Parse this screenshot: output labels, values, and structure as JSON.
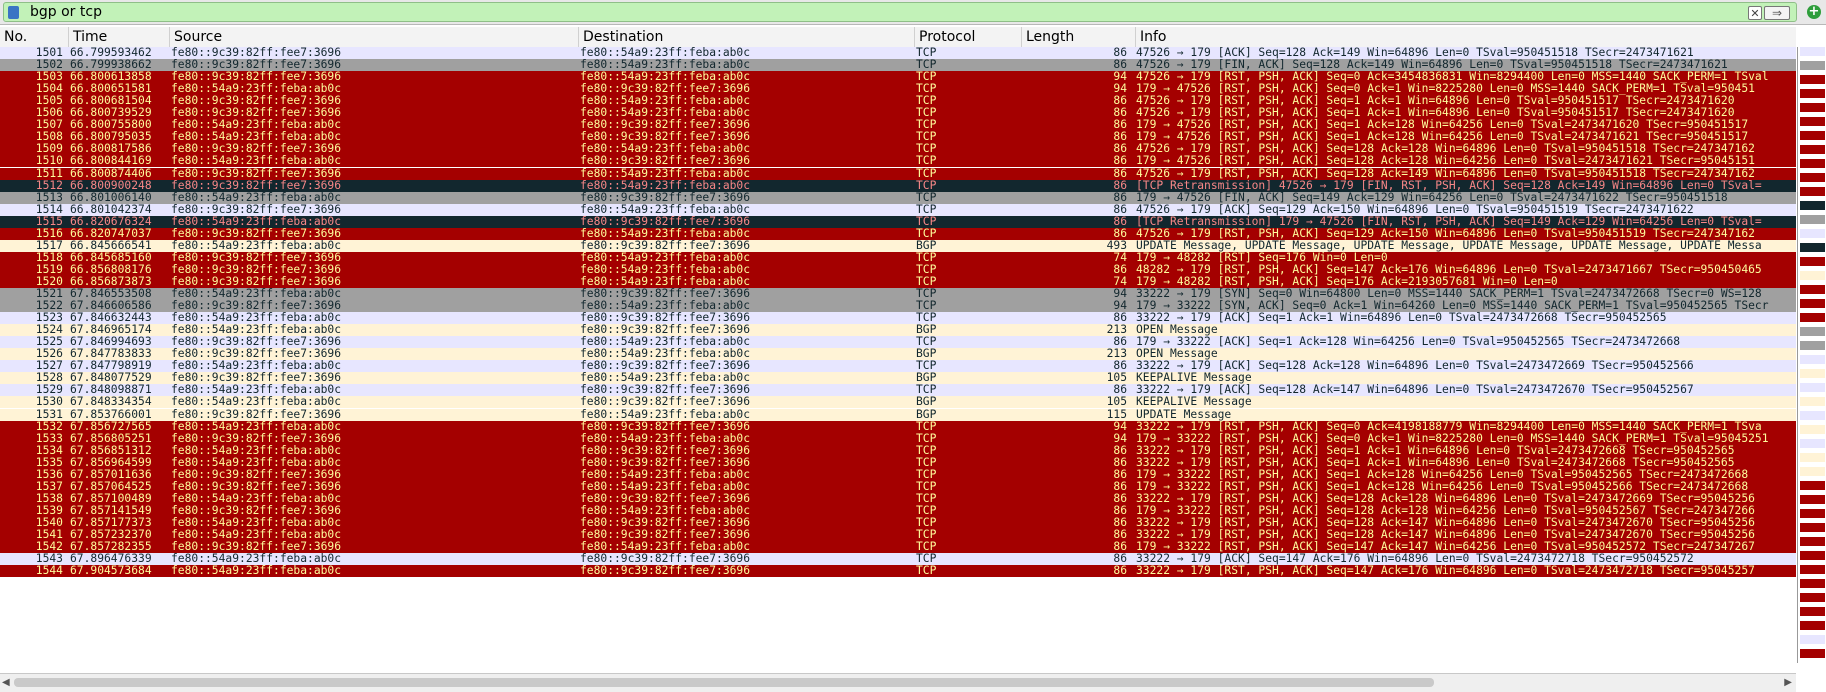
{
  "filter": {
    "text": "bgp or tcp",
    "clear_symbol": "✕",
    "apply_symbol": "⇒",
    "add_symbol": "+"
  },
  "columns": [
    "No.",
    "Time",
    "Source",
    "Destination",
    "Protocol",
    "Length",
    "Info"
  ],
  "row_styles": {
    "red": {
      "bg": "#a40000",
      "fg": "#fffc9c"
    },
    "blue": {
      "bg": "#e7e6ff",
      "fg": "#12272e"
    },
    "gray": {
      "bg": "#a0a0a0",
      "fg": "#12272e"
    },
    "dark": {
      "bg": "#12272e",
      "fg": "#f78787"
    },
    "bgp": {
      "bg": "#fff3d6",
      "fg": "#12272e"
    }
  },
  "packets": [
    {
      "no": "1501",
      "time": "66.799593462",
      "src": "fe80::9c39:82ff:fee7:3696",
      "dst": "fe80::54a9:23ff:feba:ab0c",
      "proto": "TCP",
      "len": "86",
      "info": "47526 → 179 [ACK] Seq=128 Ack=149 Win=64896 Len=0 TSval=950451518 TSecr=2473471621",
      "style": "blue"
    },
    {
      "no": "1502",
      "time": "66.799938662",
      "src": "fe80::9c39:82ff:fee7:3696",
      "dst": "fe80::54a9:23ff:feba:ab0c",
      "proto": "TCP",
      "len": "86",
      "info": "47526 → 179 [FIN, ACK] Seq=128 Ack=149 Win=64896 Len=0 TSval=950451518 TSecr=2473471621",
      "style": "gray"
    },
    {
      "no": "1503",
      "time": "66.800613858",
      "src": "fe80::9c39:82ff:fee7:3696",
      "dst": "fe80::54a9:23ff:feba:ab0c",
      "proto": "TCP",
      "len": "94",
      "info": "47526 → 179 [RST, PSH, ACK] Seq=0 Ack=3454836831 Win=8294400 Len=0 MSS=1440 SACK_PERM=1 TSval",
      "style": "red"
    },
    {
      "no": "1504",
      "time": "66.800651581",
      "src": "fe80::54a9:23ff:feba:ab0c",
      "dst": "fe80::9c39:82ff:fee7:3696",
      "proto": "TCP",
      "len": "94",
      "info": "179 → 47526 [RST, PSH, ACK] Seq=0 Ack=1 Win=8225280 Len=0 MSS=1440 SACK_PERM=1 TSval=950451",
      "style": "red"
    },
    {
      "no": "1505",
      "time": "66.800681504",
      "src": "fe80::9c39:82ff:fee7:3696",
      "dst": "fe80::54a9:23ff:feba:ab0c",
      "proto": "TCP",
      "len": "86",
      "info": "47526 → 179 [RST, PSH, ACK] Seq=1 Ack=1 Win=64896 Len=0 TSval=950451517 TSecr=2473471620",
      "style": "red"
    },
    {
      "no": "1506",
      "time": "66.800739529",
      "src": "fe80::9c39:82ff:fee7:3696",
      "dst": "fe80::54a9:23ff:feba:ab0c",
      "proto": "TCP",
      "len": "86",
      "info": "47526 → 179 [RST, PSH, ACK] Seq=1 Ack=1 Win=64896 Len=0 TSval=950451517 TSecr=2473471620",
      "style": "red"
    },
    {
      "no": "1507",
      "time": "66.800755800",
      "src": "fe80::54a9:23ff:feba:ab0c",
      "dst": "fe80::9c39:82ff:fee7:3696",
      "proto": "TCP",
      "len": "86",
      "info": "179 → 47526 [RST, PSH, ACK] Seq=1 Ack=128 Win=64256 Len=0 TSval=2473471620 TSecr=950451517",
      "style": "red"
    },
    {
      "no": "1508",
      "time": "66.800795035",
      "src": "fe80::54a9:23ff:feba:ab0c",
      "dst": "fe80::9c39:82ff:fee7:3696",
      "proto": "TCP",
      "len": "86",
      "info": "179 → 47526 [RST, PSH, ACK] Seq=1 Ack=128 Win=64256 Len=0 TSval=2473471621 TSecr=950451517",
      "style": "red"
    },
    {
      "no": "1509",
      "time": "66.800817586",
      "src": "fe80::9c39:82ff:fee7:3696",
      "dst": "fe80::54a9:23ff:feba:ab0c",
      "proto": "TCP",
      "len": "86",
      "info": "47526 → 179 [RST, PSH, ACK] Seq=128 Ack=128 Win=64896 Len=0 TSval=950451518 TSecr=247347162",
      "style": "red"
    },
    {
      "no": "1510",
      "time": "66.800844169",
      "src": "fe80::54a9:23ff:feba:ab0c",
      "dst": "fe80::9c39:82ff:fee7:3696",
      "proto": "TCP",
      "len": "86",
      "info": "179 → 47526 [RST, PSH, ACK] Seq=128 Ack=128 Win=64256 Len=0 TSval=2473471621 TSecr=95045151",
      "style": "red"
    },
    {
      "no": "1511",
      "time": "66.800874406",
      "src": "fe80::9c39:82ff:fee7:3696",
      "dst": "fe80::54a9:23ff:feba:ab0c",
      "proto": "TCP",
      "len": "86",
      "info": "47526 → 179 [RST, PSH, ACK] Seq=128 Ack=149 Win=64896 Len=0 TSval=950451518 TSecr=247347162",
      "style": "red"
    },
    {
      "no": "1512",
      "time": "66.800900248",
      "src": "fe80::9c39:82ff:fee7:3696",
      "dst": "fe80::54a9:23ff:feba:ab0c",
      "proto": "TCP",
      "len": "86",
      "info": "[TCP Retransmission] 47526 → 179 [FIN, RST, PSH, ACK] Seq=128 Ack=149 Win=64896 Len=0 TSval=",
      "style": "dark"
    },
    {
      "no": "1513",
      "time": "66.801006140",
      "src": "fe80::54a9:23ff:feba:ab0c",
      "dst": "fe80::9c39:82ff:fee7:3696",
      "proto": "TCP",
      "len": "86",
      "info": "179 → 47526 [FIN, ACK] Seq=149 Ack=129 Win=64256 Len=0 TSval=2473471622 TSecr=950451518",
      "style": "gray"
    },
    {
      "no": "1514",
      "time": "66.801042374",
      "src": "fe80::9c39:82ff:fee7:3696",
      "dst": "fe80::54a9:23ff:feba:ab0c",
      "proto": "TCP",
      "len": "86",
      "info": "47526 → 179 [ACK] Seq=129 Ack=150 Win=64896 Len=0 TSval=950451519 TSecr=2473471622",
      "style": "blue"
    },
    {
      "no": "1515",
      "time": "66.820676324",
      "src": "fe80::54a9:23ff:feba:ab0c",
      "dst": "fe80::9c39:82ff:fee7:3696",
      "proto": "TCP",
      "len": "86",
      "info": "[TCP Retransmission] 179 → 47526 [FIN, RST, PSH, ACK] Seq=149 Ack=129 Win=64256 Len=0 TSval=",
      "style": "dark"
    },
    {
      "no": "1516",
      "time": "66.820747037",
      "src": "fe80::9c39:82ff:fee7:3696",
      "dst": "fe80::54a9:23ff:feba:ab0c",
      "proto": "TCP",
      "len": "86",
      "info": "47526 → 179 [RST, PSH, ACK] Seq=129 Ack=150 Win=64896 Len=0 TSval=950451519 TSecr=247347162",
      "style": "red"
    },
    {
      "no": "1517",
      "time": "66.845666541",
      "src": "fe80::54a9:23ff:feba:ab0c",
      "dst": "fe80::9c39:82ff:fee7:3696",
      "proto": "BGP",
      "len": "493",
      "info": "UPDATE Message, UPDATE Message, UPDATE Message, UPDATE Message, UPDATE Message, UPDATE Messa",
      "style": "bgp"
    },
    {
      "no": "1518",
      "time": "66.845685160",
      "src": "fe80::9c39:82ff:fee7:3696",
      "dst": "fe80::54a9:23ff:feba:ab0c",
      "proto": "TCP",
      "len": "74",
      "info": "179 → 48282 [RST] Seq=176 Win=0 Len=0",
      "style": "red"
    },
    {
      "no": "1519",
      "time": "66.856808176",
      "src": "fe80::9c39:82ff:fee7:3696",
      "dst": "fe80::54a9:23ff:feba:ab0c",
      "proto": "TCP",
      "len": "86",
      "info": "48282 → 179 [RST, PSH, ACK] Seq=147 Ack=176 Win=64896 Len=0 TSval=2473471667 TSecr=950450465",
      "style": "red"
    },
    {
      "no": "1520",
      "time": "66.856873873",
      "src": "fe80::9c39:82ff:fee7:3696",
      "dst": "fe80::54a9:23ff:feba:ab0c",
      "proto": "TCP",
      "len": "74",
      "info": "179 → 48282 [RST, PSH, ACK] Seq=176 Ack=2193057681 Win=0 Len=0",
      "style": "red"
    },
    {
      "no": "1521",
      "time": "67.846553508",
      "src": "fe80::54a9:23ff:feba:ab0c",
      "dst": "fe80::9c39:82ff:fee7:3696",
      "proto": "TCP",
      "len": "94",
      "info": "33222 → 179 [SYN] Seq=0 Win=64800 Len=0 MSS=1440 SACK_PERM=1 TSval=2473472668 TSecr=0 WS=128",
      "style": "gray"
    },
    {
      "no": "1522",
      "time": "67.846606586",
      "src": "fe80::9c39:82ff:fee7:3696",
      "dst": "fe80::54a9:23ff:feba:ab0c",
      "proto": "TCP",
      "len": "94",
      "info": "179 → 33222 [SYN, ACK] Seq=0 Ack=1 Win=64260 Len=0 MSS=1440 SACK_PERM=1 TSval=950452565 TSecr",
      "style": "gray"
    },
    {
      "no": "1523",
      "time": "67.846632443",
      "src": "fe80::54a9:23ff:feba:ab0c",
      "dst": "fe80::9c39:82ff:fee7:3696",
      "proto": "TCP",
      "len": "86",
      "info": "33222 → 179 [ACK] Seq=1 Ack=1 Win=64896 Len=0 TSval=2473472668 TSecr=950452565",
      "style": "blue"
    },
    {
      "no": "1524",
      "time": "67.846965174",
      "src": "fe80::54a9:23ff:feba:ab0c",
      "dst": "fe80::9c39:82ff:fee7:3696",
      "proto": "BGP",
      "len": "213",
      "info": "OPEN Message",
      "style": "bgp"
    },
    {
      "no": "1525",
      "time": "67.846994693",
      "src": "fe80::9c39:82ff:fee7:3696",
      "dst": "fe80::54a9:23ff:feba:ab0c",
      "proto": "TCP",
      "len": "86",
      "info": "179 → 33222 [ACK] Seq=1 Ack=128 Win=64256 Len=0 TSval=950452565 TSecr=2473472668",
      "style": "blue"
    },
    {
      "no": "1526",
      "time": "67.847783833",
      "src": "fe80::9c39:82ff:fee7:3696",
      "dst": "fe80::54a9:23ff:feba:ab0c",
      "proto": "BGP",
      "len": "213",
      "info": "OPEN Message",
      "style": "bgp"
    },
    {
      "no": "1527",
      "time": "67.847798919",
      "src": "fe80::54a9:23ff:feba:ab0c",
      "dst": "fe80::9c39:82ff:fee7:3696",
      "proto": "TCP",
      "len": "86",
      "info": "33222 → 179 [ACK] Seq=128 Ack=128 Win=64896 Len=0 TSval=2473472669 TSecr=950452566",
      "style": "blue"
    },
    {
      "no": "1528",
      "time": "67.848077529",
      "src": "fe80::9c39:82ff:fee7:3696",
      "dst": "fe80::54a9:23ff:feba:ab0c",
      "proto": "BGP",
      "len": "105",
      "info": "KEEPALIVE Message",
      "style": "bgp"
    },
    {
      "no": "1529",
      "time": "67.848098871",
      "src": "fe80::54a9:23ff:feba:ab0c",
      "dst": "fe80::9c39:82ff:fee7:3696",
      "proto": "TCP",
      "len": "86",
      "info": "33222 → 179 [ACK] Seq=128 Ack=147 Win=64896 Len=0 TSval=2473472670 TSecr=950452567",
      "style": "blue"
    },
    {
      "no": "1530",
      "time": "67.848334354",
      "src": "fe80::54a9:23ff:feba:ab0c",
      "dst": "fe80::9c39:82ff:fee7:3696",
      "proto": "BGP",
      "len": "105",
      "info": "KEEPALIVE Message",
      "style": "bgp"
    },
    {
      "no": "1531",
      "time": "67.853766001",
      "src": "fe80::9c39:82ff:fee7:3696",
      "dst": "fe80::54a9:23ff:feba:ab0c",
      "proto": "BGP",
      "len": "115",
      "info": "UPDATE Message",
      "style": "bgp"
    },
    {
      "no": "1532",
      "time": "67.856727565",
      "src": "fe80::54a9:23ff:feba:ab0c",
      "dst": "fe80::9c39:82ff:fee7:3696",
      "proto": "TCP",
      "len": "94",
      "info": "33222 → 179 [RST, PSH, ACK] Seq=0 Ack=4198188779 Win=8294400 Len=0 MSS=1440 SACK_PERM=1 TSva",
      "style": "red"
    },
    {
      "no": "1533",
      "time": "67.856805251",
      "src": "fe80::9c39:82ff:fee7:3696",
      "dst": "fe80::54a9:23ff:feba:ab0c",
      "proto": "TCP",
      "len": "94",
      "info": "179 → 33222 [RST, PSH, ACK] Seq=0 Ack=1 Win=8225280 Len=0 MSS=1440 SACK_PERM=1 TSval=95045251",
      "style": "red"
    },
    {
      "no": "1534",
      "time": "67.856851312",
      "src": "fe80::54a9:23ff:feba:ab0c",
      "dst": "fe80::9c39:82ff:fee7:3696",
      "proto": "TCP",
      "len": "86",
      "info": "33222 → 179 [RST, PSH, ACK] Seq=1 Ack=1 Win=64896 Len=0 TSval=2473472668 TSecr=950452565",
      "style": "red"
    },
    {
      "no": "1535",
      "time": "67.856964599",
      "src": "fe80::54a9:23ff:feba:ab0c",
      "dst": "fe80::9c39:82ff:fee7:3696",
      "proto": "TCP",
      "len": "86",
      "info": "33222 → 179 [RST, PSH, ACK] Seq=1 Ack=1 Win=64896 Len=0 TSval=2473472668 TSecr=950452565",
      "style": "red"
    },
    {
      "no": "1536",
      "time": "67.857011636",
      "src": "fe80::9c39:82ff:fee7:3696",
      "dst": "fe80::54a9:23ff:feba:ab0c",
      "proto": "TCP",
      "len": "86",
      "info": "179 → 33222 [RST, PSH, ACK] Seq=1 Ack=128 Win=64256 Len=0 TSval=950452565 TSecr=2473472668",
      "style": "red"
    },
    {
      "no": "1537",
      "time": "67.857064525",
      "src": "fe80::9c39:82ff:fee7:3696",
      "dst": "fe80::54a9:23ff:feba:ab0c",
      "proto": "TCP",
      "len": "86",
      "info": "179 → 33222 [RST, PSH, ACK] Seq=1 Ack=128 Win=64256 Len=0 TSval=950452566 TSecr=2473472668",
      "style": "red"
    },
    {
      "no": "1538",
      "time": "67.857100489",
      "src": "fe80::54a9:23ff:feba:ab0c",
      "dst": "fe80::9c39:82ff:fee7:3696",
      "proto": "TCP",
      "len": "86",
      "info": "33222 → 179 [RST, PSH, ACK] Seq=128 Ack=128 Win=64896 Len=0 TSval=2473472669 TSecr=95045256",
      "style": "red"
    },
    {
      "no": "1539",
      "time": "67.857141549",
      "src": "fe80::9c39:82ff:fee7:3696",
      "dst": "fe80::54a9:23ff:feba:ab0c",
      "proto": "TCP",
      "len": "86",
      "info": "179 → 33222 [RST, PSH, ACK] Seq=128 Ack=128 Win=64256 Len=0 TSval=950452567 TSecr=247347266",
      "style": "red"
    },
    {
      "no": "1540",
      "time": "67.857177373",
      "src": "fe80::54a9:23ff:feba:ab0c",
      "dst": "fe80::9c39:82ff:fee7:3696",
      "proto": "TCP",
      "len": "86",
      "info": "33222 → 179 [RST, PSH, ACK] Seq=128 Ack=147 Win=64896 Len=0 TSval=2473472670 TSecr=95045256",
      "style": "red"
    },
    {
      "no": "1541",
      "time": "67.857232370",
      "src": "fe80::54a9:23ff:feba:ab0c",
      "dst": "fe80::9c39:82ff:fee7:3696",
      "proto": "TCP",
      "len": "86",
      "info": "33222 → 179 [RST, PSH, ACK] Seq=128 Ack=147 Win=64896 Len=0 TSval=2473472670 TSecr=95045256",
      "style": "red"
    },
    {
      "no": "1542",
      "time": "67.857282355",
      "src": "fe80::9c39:82ff:fee7:3696",
      "dst": "fe80::54a9:23ff:feba:ab0c",
      "proto": "TCP",
      "len": "86",
      "info": "179 → 33222 [RST, PSH, ACK] Seq=147 Ack=147 Win=64256 Len=0 TSval=950452572 TSecr=247347267",
      "style": "red"
    },
    {
      "no": "1543",
      "time": "67.896476339",
      "src": "fe80::54a9:23ff:feba:ab0c",
      "dst": "fe80::9c39:82ff:fee7:3696",
      "proto": "TCP",
      "len": "86",
      "info": "33222 → 179 [ACK] Seq=147 Ack=176 Win=64896 Len=0 TSval=2473472718 TSecr=950452572",
      "style": "blue"
    },
    {
      "no": "1544",
      "time": "67.904573684",
      "src": "fe80::54a9:23ff:feba:ab0c",
      "dst": "fe80::9c39:82ff:fee7:3696",
      "proto": "TCP",
      "len": "86",
      "info": "33222 → 179 [RST, PSH, ACK] Seq=147 Ack=176 Win=64896 Len=0 TSval=2473472718 TSecr=95045257",
      "style": "red"
    }
  ],
  "scrollbar": {
    "left_arrow": "◀",
    "right_arrow": "▶"
  }
}
